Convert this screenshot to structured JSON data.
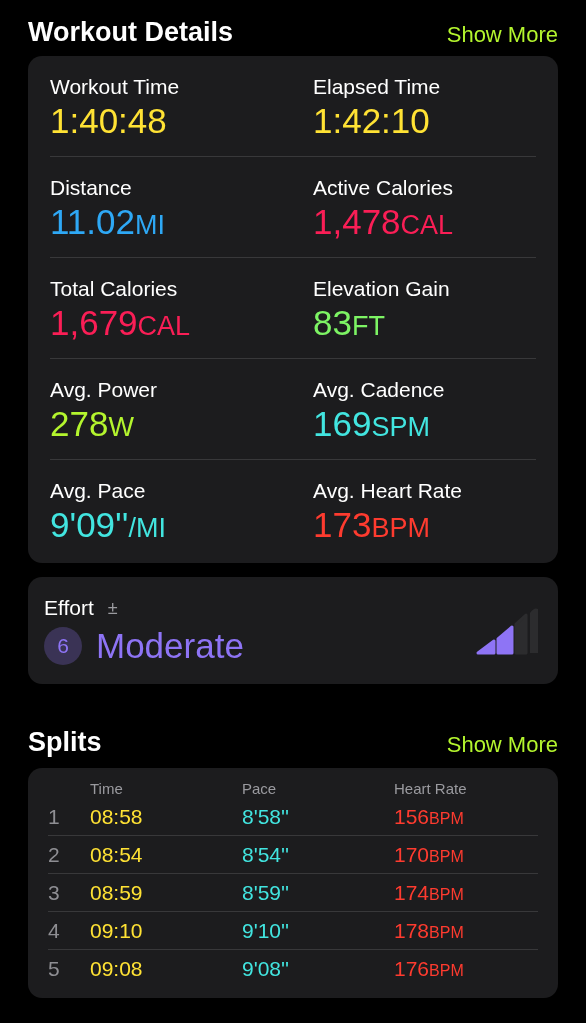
{
  "workout_details": {
    "title": "Workout Details",
    "show_more": "Show More",
    "metrics": [
      {
        "label": "Workout Time",
        "value": "1:40:48",
        "color": "#ffe234"
      },
      {
        "label": "Elapsed Time",
        "value": "1:42:10",
        "color": "#ffe234"
      },
      {
        "label": "Distance",
        "value": "11.02",
        "unit": "MI",
        "color": "#2ea8f5"
      },
      {
        "label": "Active Calories",
        "value": "1,478",
        "unit": "CAL",
        "color": "#fa1e56"
      },
      {
        "label": "Total Calories",
        "value": "1,679",
        "unit": "CAL",
        "color": "#fa1e56"
      },
      {
        "label": "Elevation Gain",
        "value": "83",
        "unit": "FT",
        "color": "#7df464"
      },
      {
        "label": "Avg. Power",
        "value": "278",
        "unit": "W",
        "color": "#b4f52e"
      },
      {
        "label": "Avg. Cadence",
        "value": "169",
        "unit": "SPM",
        "color": "#42e5e0"
      },
      {
        "label": "Avg. Pace",
        "value": "9'09''",
        "unit": "/MI",
        "color": "#42e5e0"
      },
      {
        "label": "Avg. Heart Rate",
        "value": "173",
        "unit": "BPM",
        "color": "#fe3b2f"
      }
    ]
  },
  "effort": {
    "label": "Effort",
    "adjust": "±",
    "score": "6",
    "rating": "Moderate",
    "level": 0.5
  },
  "splits": {
    "title": "Splits",
    "show_more": "Show More",
    "columns": [
      "Time",
      "Pace",
      "Heart Rate"
    ],
    "rows": [
      {
        "index": "1",
        "time": "08:58",
        "pace": "8'58''",
        "heart_rate": "156",
        "unit": "BPM"
      },
      {
        "index": "2",
        "time": "08:54",
        "pace": "8'54''",
        "heart_rate": "170",
        "unit": "BPM"
      },
      {
        "index": "3",
        "time": "08:59",
        "pace": "8'59''",
        "heart_rate": "174",
        "unit": "BPM"
      },
      {
        "index": "4",
        "time": "09:10",
        "pace": "9'10''",
        "heart_rate": "178",
        "unit": "BPM"
      },
      {
        "index": "5",
        "time": "09:08",
        "pace": "9'08''",
        "heart_rate": "176",
        "unit": "BPM"
      }
    ]
  }
}
